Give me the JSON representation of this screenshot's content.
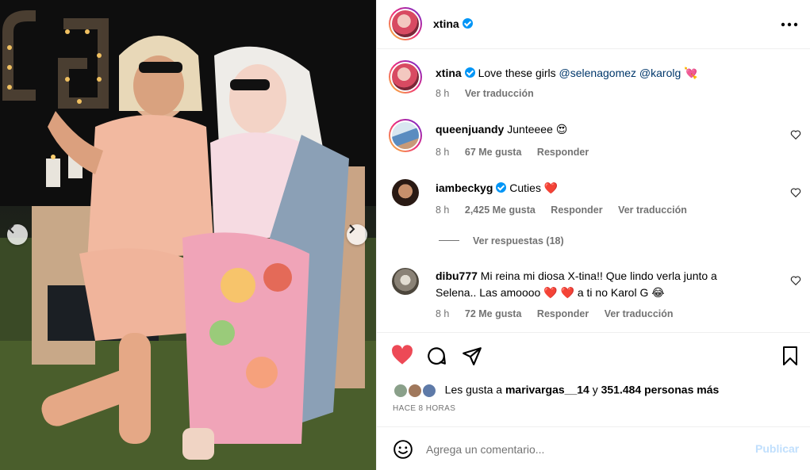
{
  "post": {
    "author": "xtina",
    "verified": true,
    "more_icon": "more-horizontal-icon",
    "caption": {
      "username": "xtina",
      "text": "Love these girls",
      "mentions": [
        "@selenagomez",
        "@karolg"
      ],
      "emoji": "💘",
      "time": "8 h",
      "translate": "Ver traducción"
    },
    "comments": [
      {
        "username": "queenjuandy",
        "text": "Junteeee 😍",
        "time": "8 h",
        "likes": "67 Me gusta",
        "reply": "Responder"
      },
      {
        "username": "iambeckyg",
        "verified": true,
        "text": "Cuties ❤️",
        "time": "8 h",
        "likes": "2,425 Me gusta",
        "reply": "Responder",
        "translate": "Ver traducción",
        "view_replies": "Ver respuestas (18)"
      },
      {
        "username": "dibu777",
        "text_line1": "Mi reina mi diosa X-tina!! Que lindo verla junto a",
        "text_line2": "Selena.. Las amoooo ❤️ ❤️  a ti no Karol G 😂",
        "time": "8 h",
        "likes": "72 Me gusta",
        "reply": "Responder",
        "translate": "Ver traducción"
      }
    ],
    "actions": [
      "heart-filled-icon",
      "comment-icon",
      "share-icon",
      "bookmark-icon"
    ],
    "likes_summary": {
      "prefix": "Les gusta a ",
      "user": "marivargas__14",
      "middle": " y ",
      "count": "351.484 personas más"
    },
    "timestamp": "HACE 8 HORAS",
    "composer": {
      "placeholder": "Agrega un comentario...",
      "publish": "Publicar",
      "emoji_icon": "emoji-smiley-icon"
    },
    "colors": {
      "accent_heart": "#ed4956",
      "link": "#00376b",
      "muted": "#737373",
      "verified": "#0095f6",
      "publish_disabled": "#c0dffd"
    }
  }
}
